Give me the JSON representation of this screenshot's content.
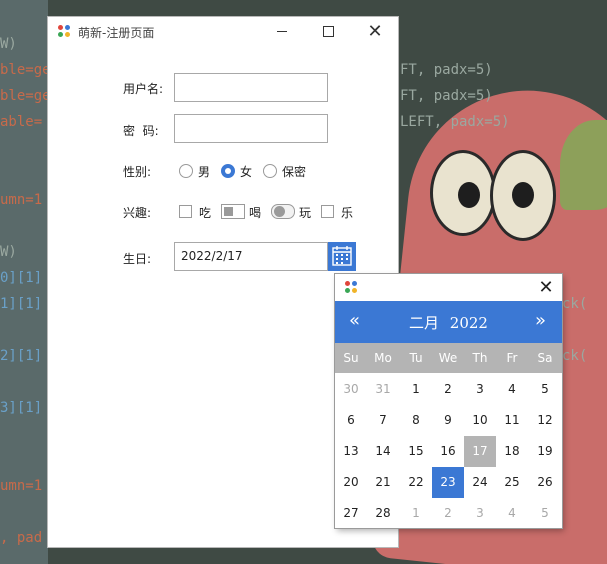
{
  "window": {
    "title": "萌新-注册页面",
    "minimize_glyph": "—",
    "maximize_glyph": "□",
    "close_glyph": "✕"
  },
  "form": {
    "username_label": "用户名:",
    "username_value": "",
    "password_label": "密  码:",
    "password_value": "",
    "gender_label": "性别:",
    "gender_options": [
      "男",
      "女",
      "保密"
    ],
    "gender_selected": "女",
    "hobby_label": "兴趣:",
    "hobby_options": [
      "吃",
      "喝",
      "玩",
      "乐"
    ],
    "birthday_label": "生日:",
    "birthday_value": "2022/2/17"
  },
  "calendar": {
    "close_glyph": "✕",
    "prev_glyph": "«",
    "next_glyph": "»",
    "month": "二月",
    "year": "2022",
    "weekdays": [
      "Su",
      "Mo",
      "Tu",
      "We",
      "Th",
      "Fr",
      "Sa"
    ],
    "weeks": [
      [
        "30",
        "31",
        "1",
        "2",
        "3",
        "4",
        "5"
      ],
      [
        "6",
        "7",
        "8",
        "9",
        "10",
        "11",
        "12"
      ],
      [
        "13",
        "14",
        "15",
        "16",
        "17",
        "18",
        "19"
      ],
      [
        "20",
        "21",
        "22",
        "23",
        "24",
        "25",
        "26"
      ],
      [
        "27",
        "28",
        "1",
        "2",
        "3",
        "4",
        "5"
      ]
    ],
    "today": "17",
    "selected": "23",
    "accent_color": "#3b78d4",
    "header_gray": "#b4b4b4"
  },
  "background": {
    "code_lines": [
      "W)",
      "ble=ge",
      "ble=ge",
      "able=",
      "umn=1",
      "W)",
      "0][1]",
      "1][1]",
      "2][1]",
      "3][1]",
      "umn=1",
      ", pad"
    ],
    "code_right": [
      "FT, padx=5)",
      "FT, padx=5)",
      "LEFT, padx=5)",
      "ck(",
      "ck("
    ]
  }
}
